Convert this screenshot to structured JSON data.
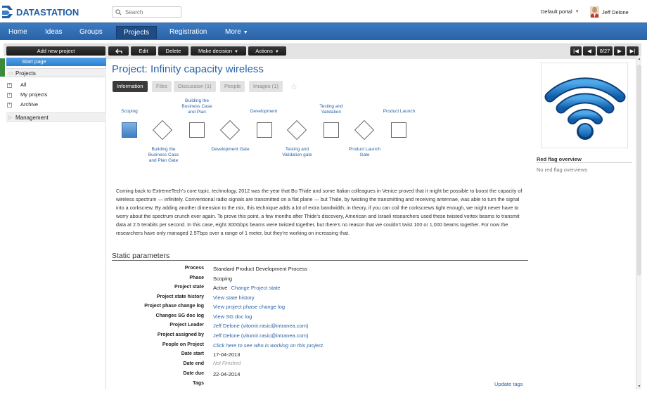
{
  "brand": {
    "name": "DATASTATION"
  },
  "search": {
    "placeholder": "Search"
  },
  "header": {
    "portal": "Default portal",
    "user_name": "Jeff Delone"
  },
  "nav": [
    {
      "label": "Home"
    },
    {
      "label": "Ideas"
    },
    {
      "label": "Groups"
    },
    {
      "label": "Projects"
    },
    {
      "label": "Registration"
    },
    {
      "label": "More"
    }
  ],
  "toolbar": {
    "add_new_project": "Add new project",
    "edit": "Edit",
    "delete": "Delete",
    "make_decision": "Make decision",
    "actions": "Actions",
    "counter": "8/27"
  },
  "sidebar": {
    "start_page": "Start page",
    "projects_header": "Projects",
    "items": [
      {
        "label": "All"
      },
      {
        "label": "My projects"
      },
      {
        "label": "Archive"
      }
    ],
    "management": "Management"
  },
  "page": {
    "title": "Project: Infinity capacity wireless"
  },
  "tabs": [
    {
      "label": "Information"
    },
    {
      "label": "Files"
    },
    {
      "label": "Discussion (1)"
    },
    {
      "label": "People"
    },
    {
      "label": "Images (1)"
    }
  ],
  "process": {
    "stages": [
      {
        "label": "Scoping"
      },
      {
        "label": "Building the Business Case and Plan"
      },
      {
        "label": "Development"
      },
      {
        "label": "Testing and Validation"
      },
      {
        "label": "Product Launch"
      }
    ],
    "gates": [
      {
        "label": "Building the Business Case and Plan Gate"
      },
      {
        "label": "Development Gate"
      },
      {
        "label": "Testing and Validation gate"
      },
      {
        "label": "Product Launch Gate"
      }
    ]
  },
  "description": "Coming back to ExtremeTech’s core topic, technology, 2012 was the year that Bo Thide and some Italian colleagues in Venice proved that it might be possible to boost the capacity of wireless spectrum — infinitely. Conventional radio signals are transmitted on a flat plane — but Thide, by twisting the transmitting and receiving antennae, was able to turn the signal into a corkscrew. By adding another dimension to the mix, this technique adds a lot of extra bandwidth; in theory, if you can coil the corkscrews tight enough, we might never have to worry about the spectrum crunch ever again. To prove this point, a few months after Thide’s discovery, American and Israeli researchers used these twisted vortex beams to transmit data at 2.5 terabits per second. In this case, eight 300Gbps beams were twisted together, but there’s no reason that we couldn’t twist 100 or 1,000 beams together. For now the researchers have only managed 2.5Tbps over a range of 1 meter, but they’re working on increasing that.",
  "static_params": {
    "title": "Static parameters",
    "rows": [
      {
        "label": "Process",
        "value": "Standard Product Development Process"
      },
      {
        "label": "Phase",
        "value": "Scoping"
      },
      {
        "label": "Project state",
        "value": "Active",
        "link": "Change Project state"
      },
      {
        "label": "Project state history",
        "link": "View state history"
      },
      {
        "label": "Project phase change log",
        "link": "View project phase change log"
      },
      {
        "label": "Changes SG doc log",
        "link": "View SG doc log"
      },
      {
        "label": "Project Leader",
        "link": "Jeff Delone (vitomir.rasic@intranea.com)"
      },
      {
        "label": "Project assigned by",
        "link": "Jeff Delone (vitomir.rasic@intranea.com)"
      },
      {
        "label": "People on Project",
        "link_italic": "Click here to see who is working on this project."
      },
      {
        "label": "Date start",
        "value": "17-04-2013"
      },
      {
        "label": "Date end",
        "muted": "Not Finished"
      },
      {
        "label": "Date due",
        "value": "22-04-2014"
      },
      {
        "label": "Tags",
        "value": ""
      }
    ],
    "update_tags": "Update tags"
  },
  "right_panel": {
    "red_flag_title": "Red flag overview",
    "red_flag_text": "No red flag overviews"
  },
  "colors": {
    "accent": "#2a63a6",
    "nav_bg": "#3170b6",
    "brand": "#2160a8"
  }
}
